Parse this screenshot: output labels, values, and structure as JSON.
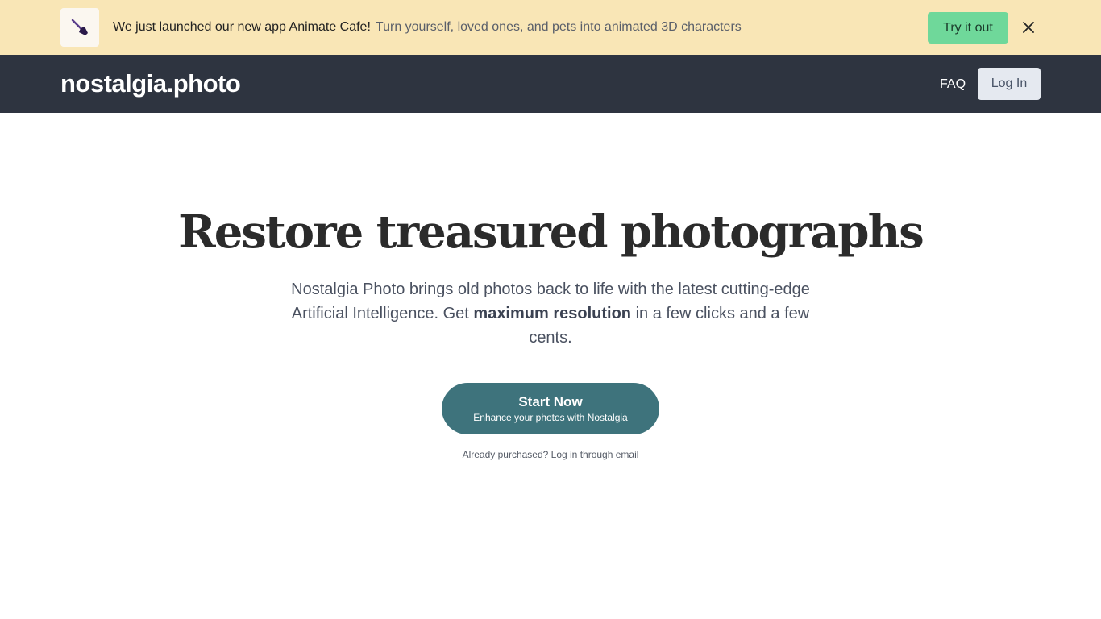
{
  "banner": {
    "icon": "paintbrush-icon",
    "headline": "We just launched our new app Animate Cafe!",
    "subtext": "Turn yourself, loved ones, and pets into animated 3D characters",
    "cta_label": "Try it out",
    "close_icon": "close-icon",
    "colors": {
      "background": "#f9e6b6",
      "cta": "#6fd89a"
    }
  },
  "nav": {
    "logo": "nostalgia.photo",
    "faq_label": "FAQ",
    "login_label": "Log In",
    "colors": {
      "background": "#2e3440"
    }
  },
  "hero": {
    "title": "Restore treasured photographs",
    "desc_prefix": "Nostalgia Photo brings old photos back to life with the latest cutting-edge Artificial Intelligence. Get ",
    "desc_bold": "maximum resolution",
    "desc_suffix": " in a few clicks and a few cents.",
    "cta_title": "Start Now",
    "cta_subtitle": "Enhance your photos with Nostalgia",
    "email_login": "Already purchased? Log in through email",
    "colors": {
      "cta": "#3e737c"
    }
  }
}
